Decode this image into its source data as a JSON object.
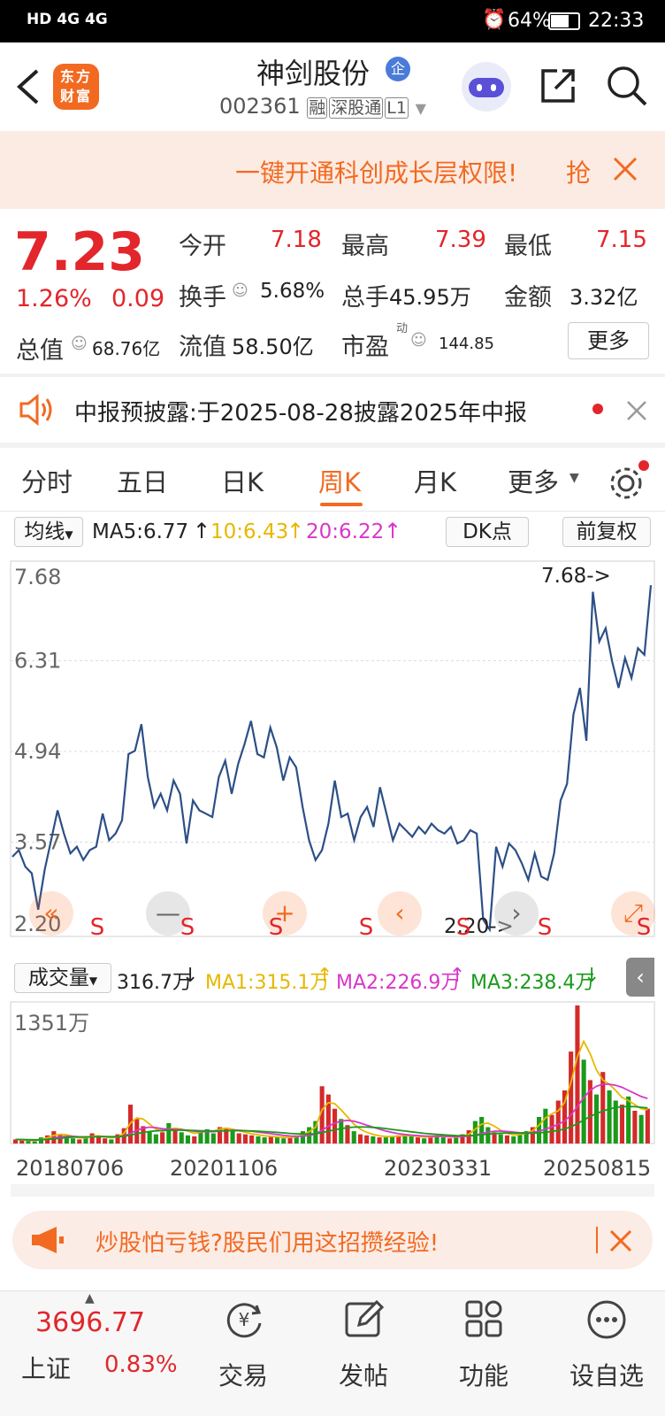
{
  "status_bar": {
    "network": "HD 4G 4G",
    "battery": "64%",
    "time": "22:33"
  },
  "header": {
    "logo_text": "东方财富",
    "stock_name": "神剑股份",
    "badge": "企",
    "stock_code": "002361",
    "tags": [
      "融",
      "深股通",
      "L1"
    ]
  },
  "banner": {
    "text": "一键开通科创成长层权限!",
    "cta": "抢"
  },
  "quote": {
    "price": "7.23",
    "change_pct": "1.26%",
    "change_amt": "0.09",
    "open_label": "今开",
    "open": "7.18",
    "high_label": "最高",
    "high": "7.39",
    "low_label": "最低",
    "low": "7.15",
    "turnover_label": "换手",
    "turnover": "5.68%",
    "volume_label": "总手",
    "volume": "45.95万",
    "amount_label": "金额",
    "amount": "3.32亿",
    "mktcap_label": "总值",
    "mktcap": "68.76亿",
    "float_label": "流值",
    "float": "58.50亿",
    "pe_label": "市盈",
    "pe_sup": "动",
    "pe": "144.85",
    "more_button": "更多"
  },
  "notice": {
    "text": "中报预披露:于2025-08-28披露2025年中报"
  },
  "tabs": [
    {
      "label": "分时",
      "active": false
    },
    {
      "label": "五日",
      "active": false
    },
    {
      "label": "日K",
      "active": false
    },
    {
      "label": "周K",
      "active": true
    },
    {
      "label": "月K",
      "active": false
    },
    {
      "label": "更多",
      "active": false
    }
  ],
  "indicator_bar": {
    "selector": "均线",
    "ma5": "MA5:6.77",
    "ma10": "10:6.43",
    "ma20": "20:6.22",
    "dk_button": "DK点",
    "adjust_button": "前复权"
  },
  "volume_bar": {
    "selector": "成交量",
    "value": "316.7万",
    "ma1": "MA1:315.1万",
    "ma2": "MA2:226.9万",
    "ma3": "MA3:238.4万"
  },
  "colors": {
    "accent": "#f26a21",
    "up": "#e2262b",
    "line": "#2c4f86",
    "ma1": "#e6b800",
    "ma2": "#d936c9",
    "ma3": "#1a9a1a"
  },
  "chart_data": {
    "type": "line",
    "title": "",
    "x_tick_labels": [
      "20180706",
      "20201106",
      "20230331",
      "20250815"
    ],
    "y_tick_labels": [
      "7.68",
      "6.31",
      "4.94",
      "3.57",
      "2.20"
    ],
    "ylim": [
      2.2,
      7.68
    ],
    "max_label": "7.68->",
    "min_label": "2.20->",
    "s_markers": [
      "S",
      "S",
      "S",
      "S",
      "S",
      "S",
      "S"
    ],
    "series": [
      {
        "values": [
          3.35,
          3.45,
          3.2,
          3.1,
          2.55,
          3.15,
          3.6,
          4.05,
          3.7,
          3.4,
          3.5,
          3.3,
          3.45,
          3.5,
          4.0,
          3.6,
          3.7,
          3.9,
          4.9,
          4.95,
          5.35,
          4.55,
          4.1,
          4.3,
          4.05,
          4.5,
          4.3,
          3.55,
          4.2,
          4.05,
          4.0,
          3.95,
          4.55,
          4.8,
          4.3,
          4.75,
          5.05,
          5.4,
          4.9,
          4.85,
          5.3,
          5.0,
          4.5,
          4.85,
          4.7,
          4.1,
          3.6,
          3.3,
          3.45,
          3.85,
          4.5,
          3.95,
          4.0,
          3.6,
          3.95,
          4.1,
          3.8,
          4.4,
          4.0,
          3.6,
          3.85,
          3.75,
          3.65,
          3.8,
          3.7,
          3.85,
          3.75,
          3.7,
          3.8,
          3.55,
          3.6,
          3.75,
          3.7,
          2.4,
          2.25,
          3.5,
          3.2,
          3.55,
          3.45,
          3.25,
          3.0,
          3.4,
          3.05,
          3.0,
          3.4,
          4.2,
          4.45,
          5.5,
          5.9,
          5.1,
          7.35,
          6.6,
          6.8,
          6.3,
          5.9,
          6.35,
          6.05,
          6.5,
          6.4,
          7.45
        ]
      }
    ],
    "volume": {
      "ylabel": "1351万",
      "max": 1351,
      "values": [
        40,
        30,
        25,
        20,
        60,
        80,
        120,
        90,
        70,
        50,
        40,
        60,
        100,
        70,
        50,
        40,
        90,
        150,
        380,
        240,
        170,
        120,
        90,
        110,
        200,
        140,
        110,
        80,
        70,
        120,
        140,
        100,
        160,
        150,
        120,
        100,
        90,
        80,
        70,
        60,
        70,
        60,
        50,
        60,
        80,
        120,
        160,
        220,
        560,
        480,
        340,
        240,
        180,
        120,
        90,
        80,
        70,
        60,
        60,
        70,
        80,
        90,
        70,
        60,
        50,
        70,
        80,
        60,
        50,
        60,
        90,
        130,
        220,
        260,
        160,
        110,
        90,
        80,
        70,
        90,
        120,
        160,
        260,
        340,
        280,
        420,
        520,
        900,
        1351,
        820,
        620,
        480,
        700,
        520,
        420,
        380,
        460,
        320,
        280,
        340
      ],
      "ma1": [
        40,
        35,
        30,
        28,
        40,
        55,
        80,
        90,
        85,
        70,
        55,
        55,
        70,
        75,
        65,
        55,
        65,
        100,
        200,
        250,
        240,
        190,
        140,
        120,
        140,
        150,
        140,
        120,
        100,
        110,
        125,
        120,
        140,
        150,
        140,
        125,
        110,
        95,
        85,
        75,
        70,
        65,
        60,
        60,
        65,
        85,
        115,
        160,
        330,
        400,
        390,
        330,
        260,
        190,
        140,
        110,
        90,
        75,
        68,
        68,
        72,
        78,
        76,
        70,
        64,
        64,
        70,
        70,
        64,
        62,
        70,
        90,
        140,
        190,
        200,
        170,
        130,
        100,
        85,
        88,
        100,
        125,
        180,
        250,
        290,
        320,
        400,
        600,
        850,
        1000,
        880,
        720,
        620,
        580,
        520,
        450,
        420,
        380,
        340,
        330
      ],
      "ma2": [
        40,
        38,
        35,
        33,
        36,
        42,
        55,
        65,
        70,
        70,
        66,
        63,
        65,
        68,
        68,
        65,
        64,
        72,
        100,
        130,
        150,
        160,
        155,
        145,
        140,
        138,
        136,
        130,
        120,
        116,
        116,
        116,
        120,
        126,
        130,
        130,
        126,
        120,
        112,
        104,
        96,
        88,
        80,
        74,
        70,
        72,
        80,
        92,
        130,
        170,
        200,
        220,
        226,
        218,
        200,
        180,
        160,
        140,
        122,
        108,
        96,
        88,
        82,
        78,
        74,
        72,
        71,
        70,
        68,
        67,
        68,
        72,
        82,
        98,
        112,
        120,
        122,
        118,
        112,
        106,
        104,
        108,
        120,
        140,
        162,
        188,
        220,
        280,
        360,
        450,
        520,
        560,
        580,
        580,
        570,
        550,
        520,
        490,
        460,
        440
      ],
      "ma3": [
        40,
        39,
        37,
        36,
        37,
        40,
        46,
        52,
        58,
        62,
        64,
        65,
        66,
        67,
        67,
        67,
        67,
        70,
        82,
        96,
        108,
        118,
        124,
        127,
        129,
        130,
        130,
        129,
        127,
        125,
        124,
        123,
        124,
        125,
        126,
        126,
        125,
        123,
        120,
        117,
        113,
        109,
        104,
        99,
        95,
        93,
        93,
        95,
        106,
        120,
        134,
        146,
        155,
        160,
        162,
        161,
        158,
        153,
        146,
        138,
        130,
        122,
        114,
        107,
        100,
        94,
        89,
        85,
        81,
        78,
        77,
        77,
        80,
        86,
        92,
        97,
        101,
        103,
        103,
        102,
        101,
        101,
        104,
        110,
        118,
        128,
        142,
        164,
        194,
        230,
        264,
        294,
        318,
        338,
        352,
        360,
        362,
        360,
        354,
        348
      ]
    }
  },
  "ad": {
    "text": "炒股怕亏钱?股民们用这招攒经验!"
  },
  "bottom_bar": {
    "index_value": "3696.77",
    "index_name": "上证",
    "index_change": "0.83%",
    "items": [
      "交易",
      "发帖",
      "功能",
      "设自选"
    ]
  }
}
